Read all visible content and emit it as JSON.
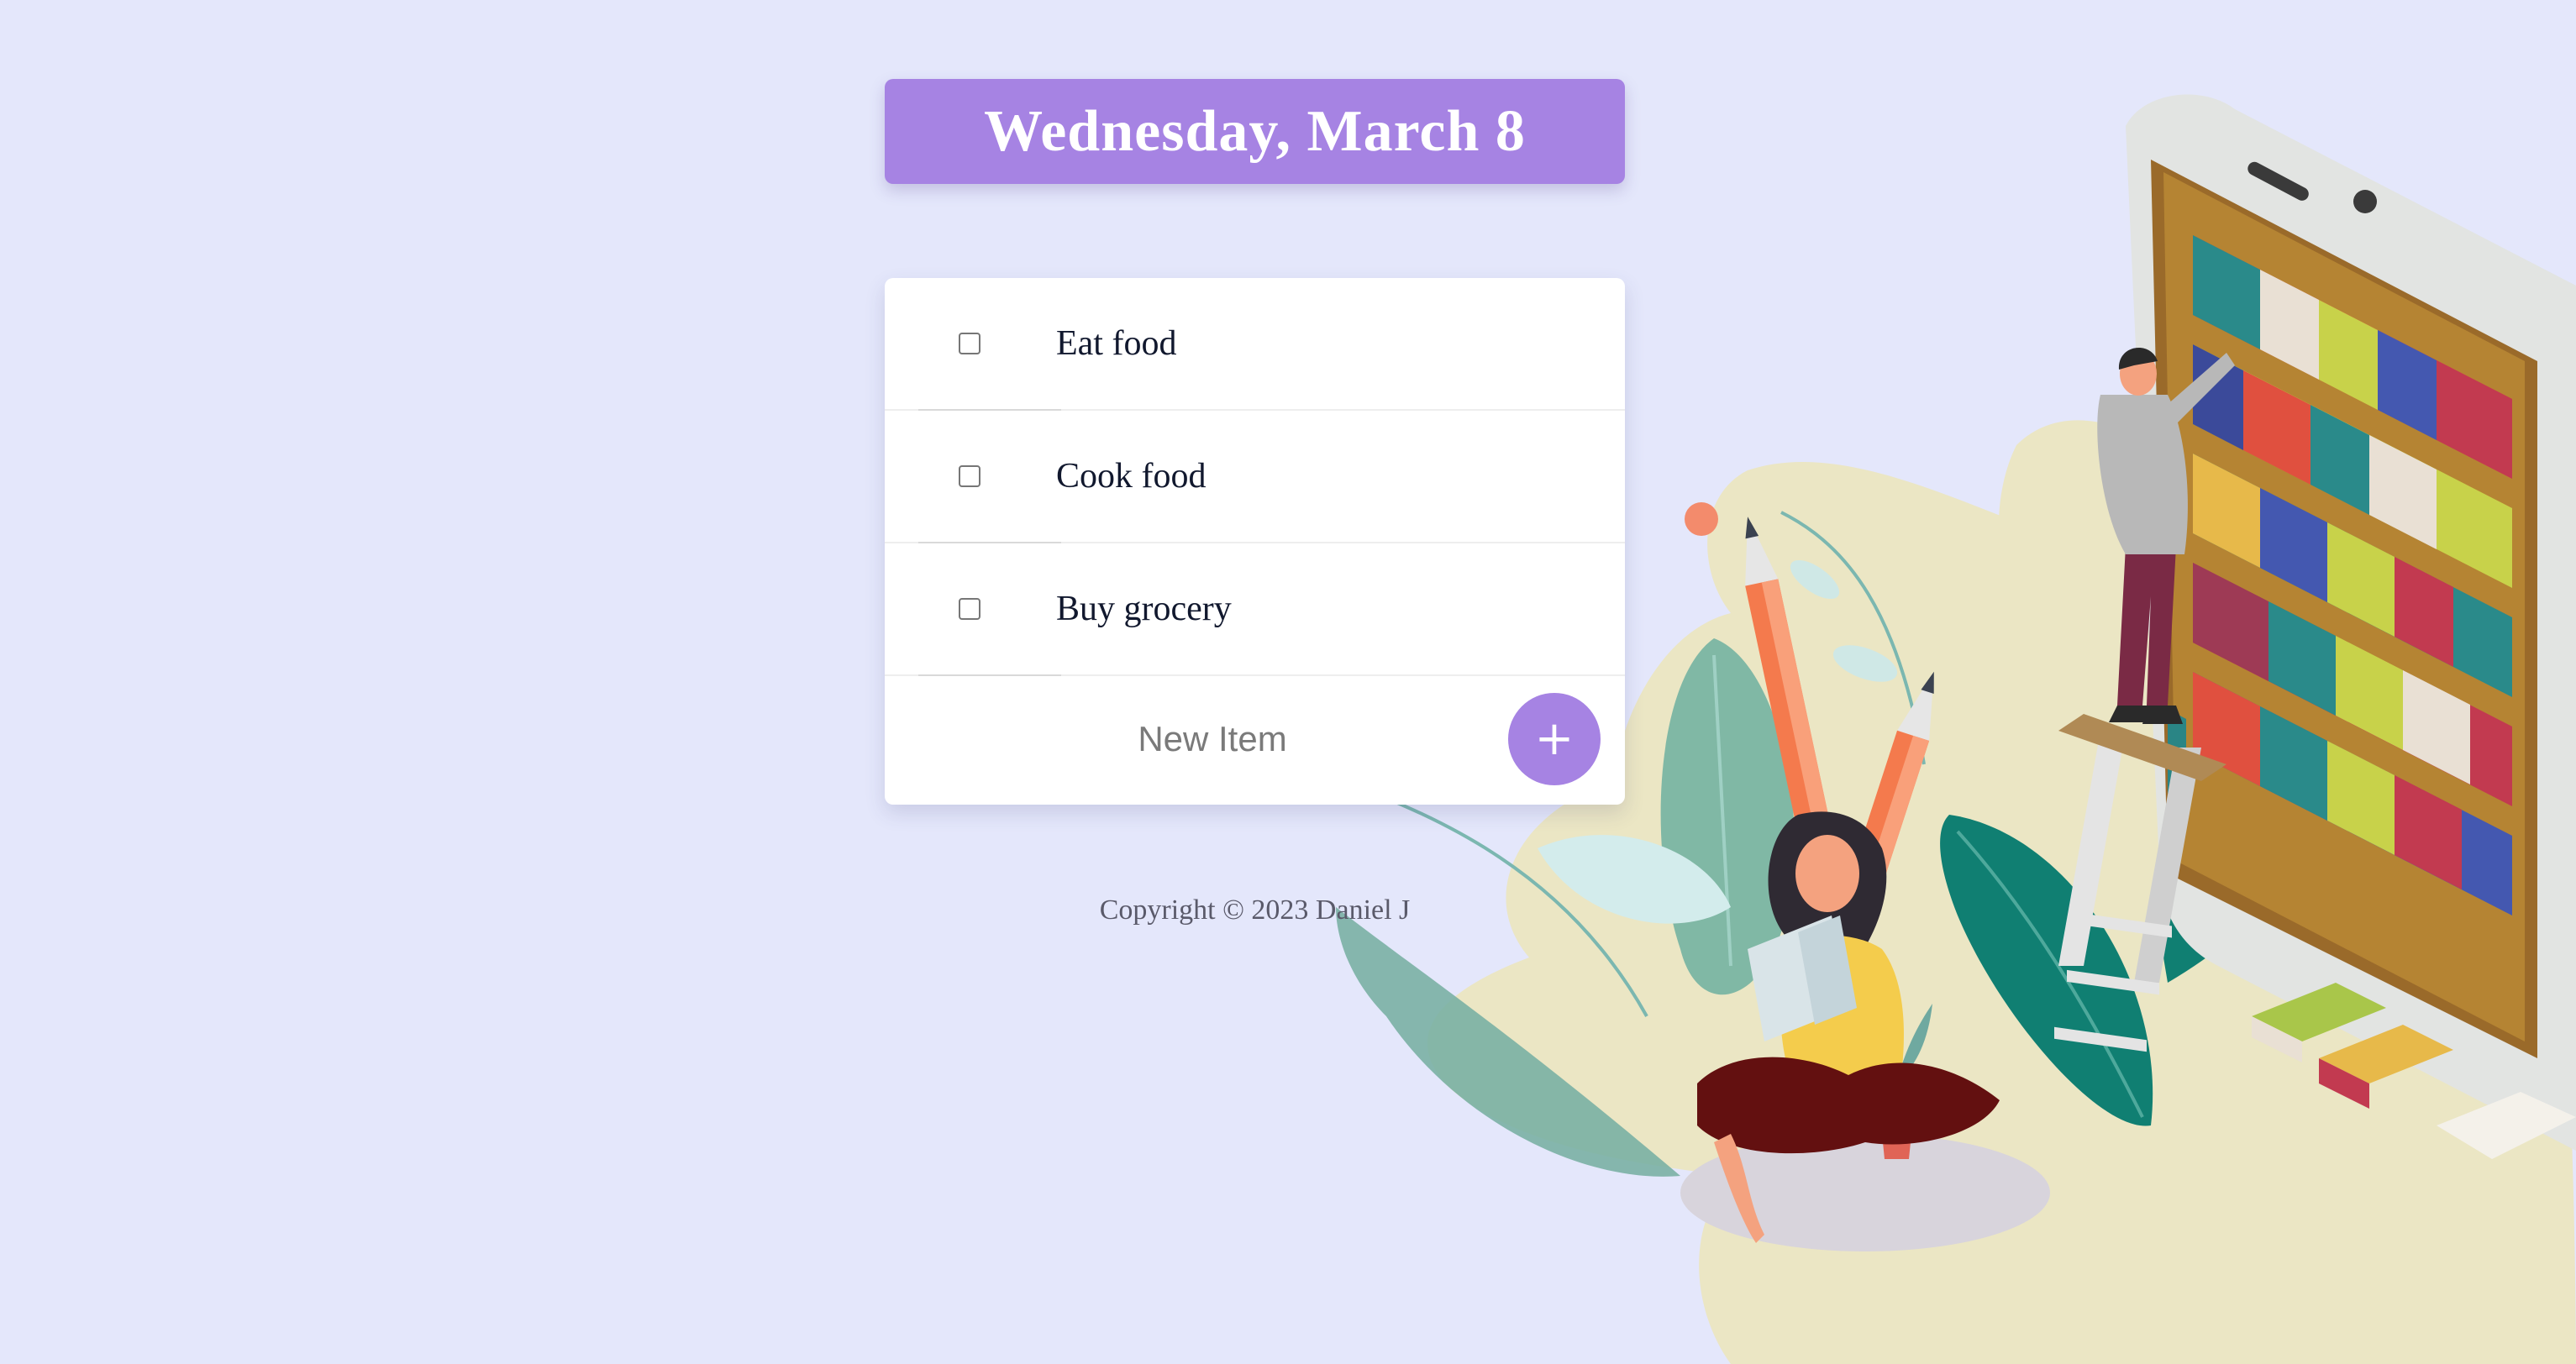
{
  "header": {
    "date_title": "Wednesday, March 8"
  },
  "todo": {
    "items": [
      {
        "text": "Eat food",
        "checked": false
      },
      {
        "text": "Cook food",
        "checked": false
      },
      {
        "text": "Buy grocery",
        "checked": false
      }
    ],
    "new_item_placeholder": "New Item",
    "add_button_label": "+"
  },
  "footer": {
    "copyright": "Copyright © 2023 Daniel J"
  },
  "colors": {
    "background": "#e4e7fb",
    "accent": "#a683e3",
    "card": "#ffffff",
    "text": "#11182e"
  },
  "illustration": {
    "name": "reading-library-illustration"
  }
}
